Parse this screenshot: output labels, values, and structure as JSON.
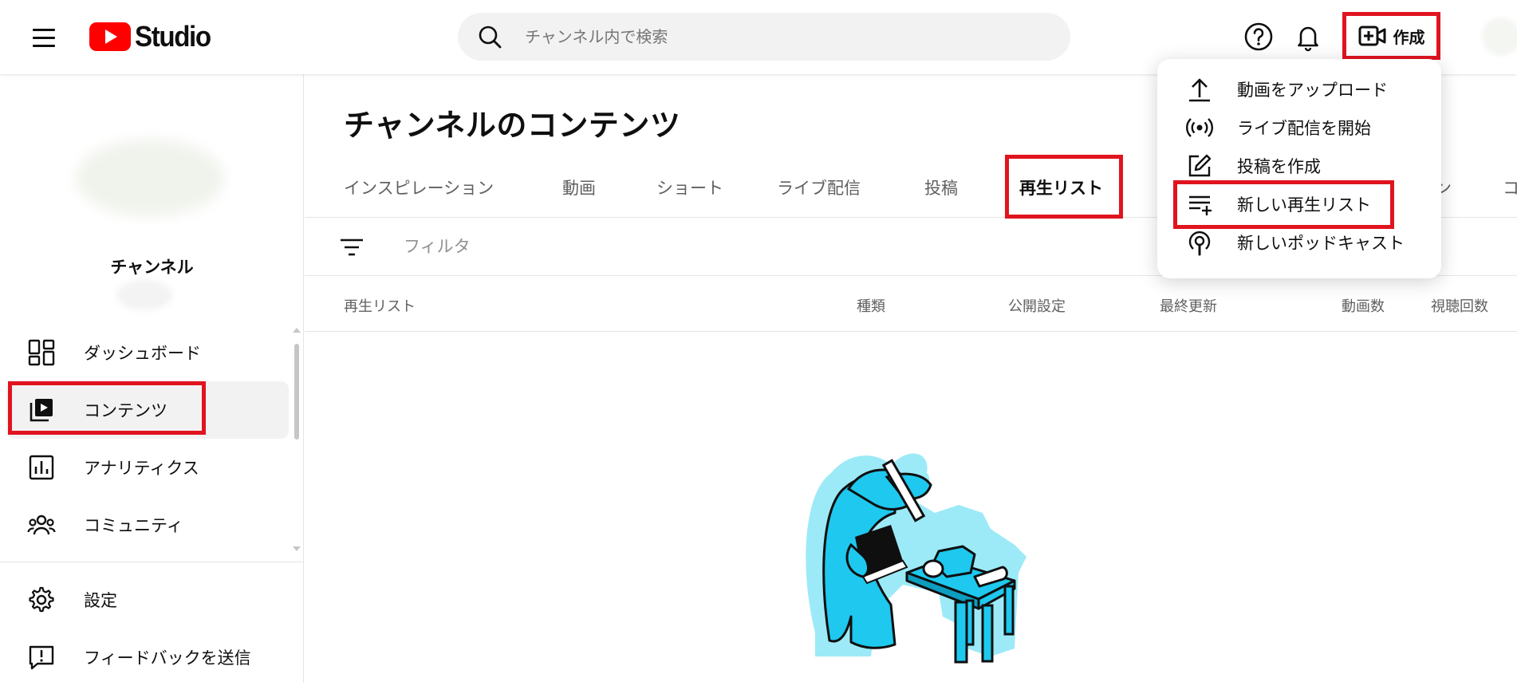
{
  "header": {
    "logo_text": "Studio",
    "search_placeholder": "チャンネル内で検索",
    "create_label": "作成",
    "brand_color": "#ff0000",
    "highlight_color": "#e0141f"
  },
  "sidebar": {
    "channel_label": "チャンネル",
    "items": [
      {
        "label": "ダッシュボード",
        "icon": "dashboard-icon"
      },
      {
        "label": "コンテンツ",
        "icon": "content-icon",
        "active": true
      },
      {
        "label": "アナリティクス",
        "icon": "analytics-icon"
      },
      {
        "label": "コミュニティ",
        "icon": "community-icon"
      }
    ],
    "bottom_items": [
      {
        "label": "設定",
        "icon": "settings-icon"
      },
      {
        "label": "フィードバックを送信",
        "icon": "feedback-icon"
      }
    ]
  },
  "main": {
    "title": "チャンネルのコンテンツ",
    "tabs": [
      {
        "label": "インスピレーション"
      },
      {
        "label": "動画"
      },
      {
        "label": "ショート"
      },
      {
        "label": "ライブ配信"
      },
      {
        "label": "投稿"
      },
      {
        "label": "再生リスト",
        "active": true
      },
      {
        "label": "ポッドキャスト",
        "visible_fragment": "ン"
      },
      {
        "label": "コ",
        "visible_fragment": "コ"
      }
    ],
    "filter_placeholder": "フィルタ",
    "columns": [
      "再生リスト",
      "種類",
      "公開設定",
      "最終更新",
      "動画数",
      "視聴回数"
    ]
  },
  "create_menu": {
    "items": [
      {
        "label": "動画をアップロード",
        "icon": "upload-icon"
      },
      {
        "label": "ライブ配信を開始",
        "icon": "live-icon"
      },
      {
        "label": "投稿を作成",
        "icon": "edit-icon"
      },
      {
        "label": "新しい再生リスト",
        "icon": "playlist-add-icon",
        "highlighted": true
      },
      {
        "label": "新しいポッドキャスト",
        "icon": "podcast-icon"
      }
    ]
  }
}
